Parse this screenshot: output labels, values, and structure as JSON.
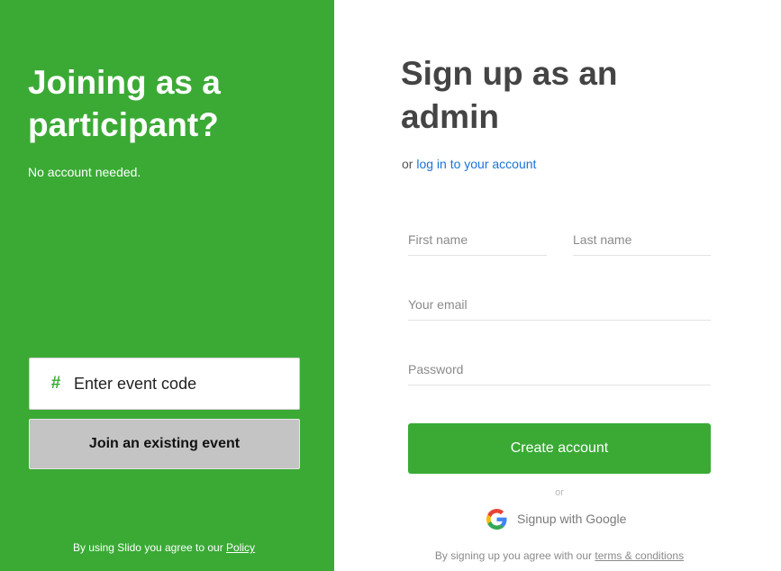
{
  "participant": {
    "title": "Joining as a participant?",
    "subtitle": "No account needed.",
    "event_code_placeholder": "Enter event code",
    "hash_symbol": "#",
    "join_button_label": "Join an existing event",
    "footer_text": "By using Slido you agree to our ",
    "footer_link": "Policy"
  },
  "admin": {
    "title": "Sign up as an admin",
    "login_prefix": "or ",
    "login_link": "log in to your account",
    "first_name_placeholder": "First name",
    "last_name_placeholder": "Last name",
    "email_placeholder": "Your email",
    "password_placeholder": "Password",
    "create_button_label": "Create account",
    "or_label": "or",
    "google_button_label": "Signup with Google",
    "terms_prefix": "By signing up you agree with our ",
    "terms_link": "terms & conditions"
  },
  "colors": {
    "brand_green": "#3aaa35",
    "join_button_bg": "#c4c4c4",
    "link_blue": "#1a73d9",
    "title_gray": "#444444"
  },
  "icons": {
    "hash": "hash-icon",
    "google": "google-logo-icon"
  }
}
